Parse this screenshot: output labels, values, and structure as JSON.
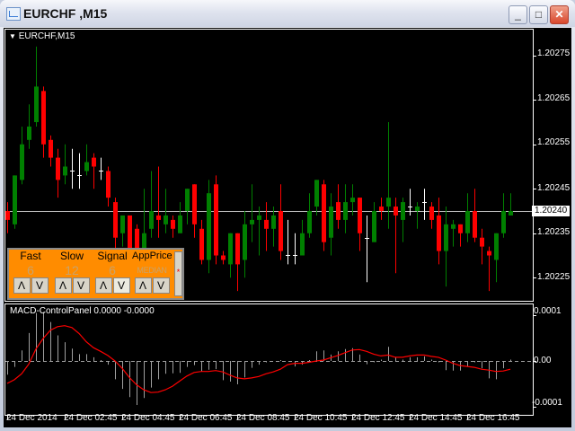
{
  "window": {
    "title": "EURCHF ,M15",
    "minimize": "_",
    "maximize": "□",
    "close": "✕"
  },
  "chart": {
    "symbol_label": "EURCHF,M15",
    "price_labels": [
      "1.20275",
      "1.20265",
      "1.20255",
      "1.20245",
      "1.20235",
      "1.20225"
    ],
    "bid_label": "1.20240",
    "macd_label": "MACD-ControlPanel 0.0000 -0.0000",
    "macd_axis_labels": [
      "0.0001",
      "0.00",
      "-0.0001"
    ],
    "time_labels": [
      "24 Dec 2014",
      "24 Dec 02:45",
      "24 Dec 04:45",
      "24 Dec 06:45",
      "24 Dec 08:45",
      "24 Dec 10:45",
      "24 Dec 12:45",
      "24 Dec 14:45",
      "24 Dec 16:45"
    ]
  },
  "panel": {
    "fields": [
      {
        "label": "Fast",
        "value": "6",
        "up": "Λ",
        "down": "V"
      },
      {
        "label": "Slow",
        "value": "12",
        "up": "Λ",
        "down": "V"
      },
      {
        "label": "Signal",
        "value": "6",
        "up": "Λ",
        "down": "V"
      },
      {
        "label": "AppPrice",
        "value": "MEDIAN",
        "up": "Λ",
        "down": "V"
      }
    ],
    "side_mark": "*"
  },
  "colors": {
    "bull": "#008000",
    "bear": "#ff0000",
    "doji": "#ffffff",
    "macd_hist": "#a0a0a0",
    "signal": "#ff0000",
    "panel": "#ff8c00"
  },
  "chart_data": {
    "type": "candlestick",
    "bid": 1.2024,
    "price_range": [
      1.2022,
      1.2028
    ],
    "candles_ohlc": [
      [
        1.2024,
        1.20242,
        1.20235,
        1.20238
      ],
      [
        1.20237,
        1.20248,
        1.20236,
        1.20248
      ],
      [
        1.20247,
        1.20259,
        1.20246,
        1.20255
      ],
      [
        1.20256,
        1.20264,
        1.20254,
        1.20259
      ],
      [
        1.2026,
        1.20277,
        1.20259,
        1.20268
      ],
      [
        1.20267,
        1.20268,
        1.20252,
        1.20255
      ],
      [
        1.20256,
        1.20257,
        1.2025,
        1.20252
      ],
      [
        1.20252,
        1.20254,
        1.20243,
        1.20247
      ],
      [
        1.20248,
        1.20255,
        1.20246,
        1.2025
      ],
      [
        1.20249,
        1.20254,
        1.20245,
        1.20249
      ],
      [
        1.20248,
        1.20253,
        1.20245,
        1.20248
      ],
      [
        1.20249,
        1.20255,
        1.20248,
        1.20251
      ],
      [
        1.20252,
        1.20253,
        1.20245,
        1.2025
      ],
      [
        1.20249,
        1.20252,
        1.20247,
        1.20249
      ],
      [
        1.20249,
        1.2025,
        1.20241,
        1.20243
      ],
      [
        1.20242,
        1.20243,
        1.20229,
        1.20234
      ],
      [
        1.20235,
        1.20239,
        1.20232,
        1.20239
      ],
      [
        1.20239,
        1.20239,
        1.20228,
        1.20229
      ],
      [
        1.20236,
        1.20237,
        1.20227,
        1.20229
      ],
      [
        1.20227,
        1.20245,
        1.20226,
        1.20235
      ],
      [
        1.20236,
        1.20249,
        1.20234,
        1.2024
      ],
      [
        1.20239,
        1.2025,
        1.20234,
        1.20238
      ],
      [
        1.20237,
        1.20245,
        1.20235,
        1.20239
      ],
      [
        1.20238,
        1.20239,
        1.20234,
        1.20236
      ],
      [
        1.20235,
        1.20242,
        1.20235,
        1.20239
      ],
      [
        1.2024,
        1.20245,
        1.20237,
        1.20245
      ],
      [
        1.20246,
        1.20246,
        1.20234,
        1.20237
      ],
      [
        1.20236,
        1.20238,
        1.20228,
        1.20229
      ],
      [
        1.20229,
        1.20247,
        1.20226,
        1.20244
      ],
      [
        1.20246,
        1.20248,
        1.20228,
        1.2023
      ],
      [
        1.2023,
        1.20231,
        1.20228,
        1.20229
      ],
      [
        1.20228,
        1.20235,
        1.20225,
        1.20235
      ],
      [
        1.20235,
        1.20235,
        1.20222,
        1.20228
      ],
      [
        1.20229,
        1.2024,
        1.20225,
        1.20237
      ],
      [
        1.20237,
        1.20246,
        1.20233,
        1.20238
      ],
      [
        1.20238,
        1.20241,
        1.2023,
        1.20239
      ],
      [
        1.20238,
        1.20242,
        1.20231,
        1.20236
      ],
      [
        1.20236,
        1.20241,
        1.20232,
        1.20239
      ],
      [
        1.2024,
        1.20246,
        1.20229,
        1.20231
      ],
      [
        1.2023,
        1.20238,
        1.20228,
        1.2023
      ],
      [
        1.2023,
        1.20235,
        1.20228,
        1.2023
      ],
      [
        1.2023,
        1.20238,
        1.2023,
        1.20235
      ],
      [
        1.20235,
        1.20244,
        1.20234,
        1.2024
      ],
      [
        1.20241,
        1.20247,
        1.20239,
        1.20247
      ],
      [
        1.20246,
        1.20247,
        1.20231,
        1.20233
      ],
      [
        1.20234,
        1.20244,
        1.2023,
        1.20241
      ],
      [
        1.20242,
        1.20246,
        1.20236,
        1.20238
      ],
      [
        1.20238,
        1.20246,
        1.20235,
        1.20242
      ],
      [
        1.20242,
        1.20246,
        1.20239,
        1.20243
      ],
      [
        1.20243,
        1.20243,
        1.20231,
        1.20235
      ],
      [
        1.20234,
        1.20239,
        1.20224,
        1.20234
      ],
      [
        1.20233,
        1.20242,
        1.20233,
        1.2024
      ],
      [
        1.20241,
        1.20243,
        1.20238,
        1.2024
      ],
      [
        1.20241,
        1.2026,
        1.20236,
        1.20243
      ],
      [
        1.20241,
        1.20243,
        1.20226,
        1.20239
      ],
      [
        1.20238,
        1.20243,
        1.20233,
        1.20242
      ],
      [
        1.20241,
        1.20245,
        1.20239,
        1.20241
      ],
      [
        1.2024,
        1.20242,
        1.20236,
        1.20241
      ],
      [
        1.20242,
        1.20245,
        1.20238,
        1.20242
      ],
      [
        1.20241,
        1.20242,
        1.20236,
        1.20238
      ],
      [
        1.20239,
        1.20243,
        1.20228,
        1.20231
      ],
      [
        1.20231,
        1.20241,
        1.20223,
        1.20237
      ],
      [
        1.20236,
        1.20238,
        1.20232,
        1.20237
      ],
      [
        1.20237,
        1.20237,
        1.20232,
        1.20235
      ],
      [
        1.20235,
        1.20244,
        1.20233,
        1.2024
      ],
      [
        1.2024,
        1.20245,
        1.20233,
        1.20234
      ],
      [
        1.20234,
        1.20236,
        1.20228,
        1.20232
      ],
      [
        1.20231,
        1.20232,
        1.20222,
        1.2023
      ],
      [
        1.20229,
        1.20235,
        1.20224,
        1.20235
      ],
      [
        1.20235,
        1.20244,
        1.20234,
        1.2024
      ],
      [
        1.20239,
        1.20244,
        1.20239,
        1.2024
      ]
    ],
    "macd_range": [
      -0.00011,
      0.00011
    ],
    "macd_hist": [
      -3e-05,
      -1.3e-05,
      2.3e-05,
      6.1e-05,
      0.000105,
      0.000107,
      8.5e-05,
      5.6e-05,
      4.1e-05,
      2.7e-05,
      1.5e-05,
      1.5e-05,
      8e-06,
      2e-06,
      -8e-06,
      -4e-05,
      -6.1e-05,
      -7.9e-05,
      -9.6e-05,
      -8.1e-05,
      -5.8e-05,
      -4e-05,
      -2.8e-05,
      -2.7e-05,
      -2.6e-05,
      -1.3e-05,
      -9e-06,
      -2.3e-05,
      -1.9e-05,
      -1.8e-05,
      -4.2e-05,
      -4.5e-05,
      -5.1e-05,
      -3.6e-05,
      -1.5e-05,
      -8e-06,
      -3e-06,
      0.0,
      2e-06,
      0.0,
      -1.2e-05,
      -8e-06,
      2e-06,
      2.1e-05,
      2.3e-05,
      1.4e-05,
      2.1e-05,
      2.6e-05,
      2.8e-05,
      1.4e-05,
      -7e-06,
      -3e-06,
      3e-06,
      3.1e-05,
      8e-06,
      3e-06,
      8e-06,
      8e-06,
      1e-05,
      3e-06,
      -3e-06,
      -2e-05,
      -2.1e-05,
      -2.1e-05,
      -1.2e-05,
      -3e-06,
      -1.6e-05,
      -3.8e-05,
      -4e-05,
      -1.6e-05,
      3e-06
    ],
    "macd_signal": [
      -4.9e-05,
      -4.1e-05,
      -2.8e-05,
      -7e-06,
      2.6e-05,
      4.9e-05,
      6.7e-05,
      7.5e-05,
      7.7e-05,
      7.3e-05,
      6e-05,
      4.2e-05,
      2.9e-05,
      2.1e-05,
      1.2e-05,
      0.0,
      -1.6e-05,
      -3.6e-05,
      -5.2e-05,
      -6.3e-05,
      -6.9e-05,
      -6.8e-05,
      -6.3e-05,
      -5.5e-05,
      -4.4e-05,
      -3.3e-05,
      -2.5e-05,
      -2.3e-05,
      -2.3e-05,
      -2.1e-05,
      -2.4e-05,
      -3.1e-05,
      -3.7e-05,
      -3.9e-05,
      -3.7e-05,
      -3.4e-05,
      -2.8e-05,
      -2.4e-05,
      -1.8e-05,
      -8e-06,
      -5e-06,
      -5e-06,
      -3e-06,
      0.0,
      2e-06,
      7e-06,
      1.2e-05,
      1.8e-05,
      2.4e-05,
      2.5e-05,
      2.1e-05,
      1.5e-05,
      1.1e-05,
      1.3e-05,
      8e-06,
      8e-06,
      1.1e-05,
      1.3e-05,
      1.3e-05,
      1e-05,
      8e-06,
      2e-06,
      -5e-06,
      -1e-05,
      -1.2e-05,
      -1.4e-05,
      -1.8e-05,
      -2e-05,
      -2.3e-05,
      -2.2e-05,
      -1.8e-05
    ]
  }
}
